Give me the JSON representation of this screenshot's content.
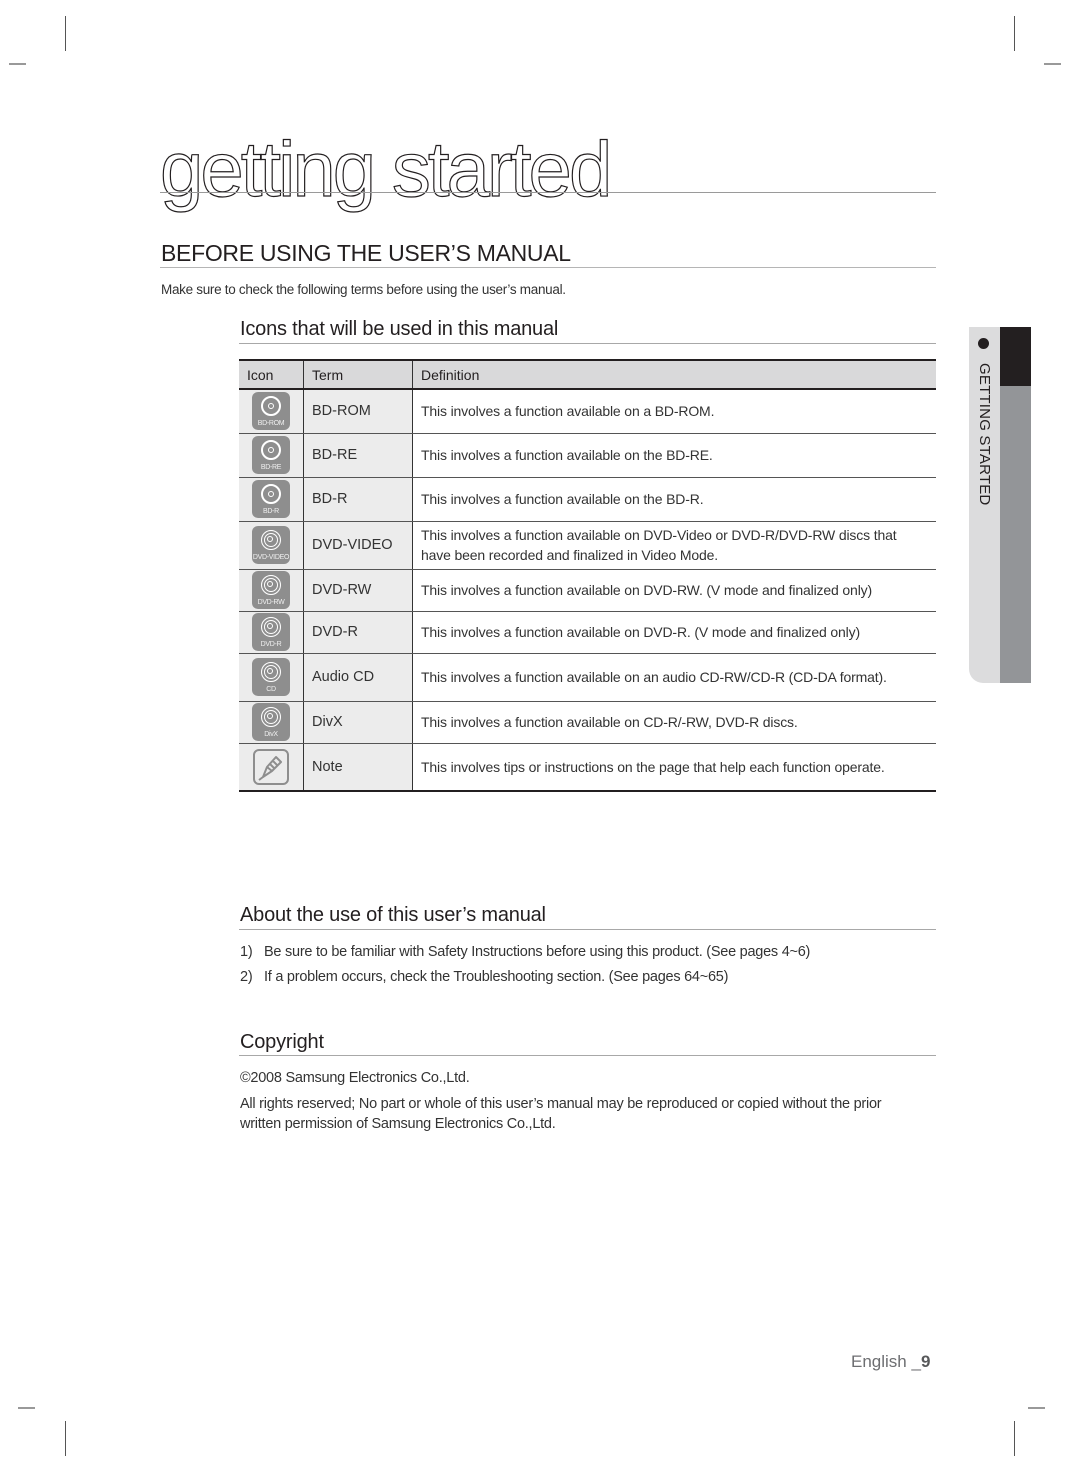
{
  "page": {
    "chapter_title": "getting started",
    "section_title": "BEFORE USING THE USER’S MANUAL",
    "intro": "Make sure to check the following terms before using the user’s manual.",
    "side_tab": {
      "label": "GETTING STARTED"
    },
    "footer": {
      "language": "English _",
      "page_number": "9"
    }
  },
  "icons_section": {
    "title": "Icons that will be used in this manual",
    "table": {
      "headers": [
        "Icon",
        "Term",
        "Definition"
      ],
      "rows": [
        {
          "icon": "bd-rom-disc-icon",
          "icon_label": "BD-ROM",
          "term": "BD-ROM",
          "definition": "This involves a function available on a BD-ROM."
        },
        {
          "icon": "bd-re-disc-icon",
          "icon_label": "BD-RE",
          "term": "BD-RE",
          "definition": "This involves a function available on the BD-RE."
        },
        {
          "icon": "bd-r-disc-icon",
          "icon_label": "BD-R",
          "term": "BD-R",
          "definition": "This involves a function available on the BD-R."
        },
        {
          "icon": "dvd-video-disc-icon",
          "icon_label": "DVD-VIDEO",
          "term": "DVD-VIDEO",
          "definition": "This involves a function available on DVD-Video or DVD-R/DVD-RW discs that have been recorded and finalized in Video Mode."
        },
        {
          "icon": "dvd-rw-disc-icon",
          "icon_label": "DVD-RW",
          "term": "DVD-RW",
          "definition": "This involves a function available on DVD-RW. (V mode and finalized only)"
        },
        {
          "icon": "dvd-r-disc-icon",
          "icon_label": "DVD-R",
          "term": "DVD-R",
          "definition": "This involves a function available on DVD-R. (V mode and finalized only)"
        },
        {
          "icon": "audio-cd-disc-icon",
          "icon_label": "CD",
          "term": "Audio CD",
          "definition": "This involves a function available on an audio CD-RW/CD-R (CD-DA format)."
        },
        {
          "icon": "divx-disc-icon",
          "icon_label": "DivX",
          "term": "DivX",
          "definition": "This involves a function available on CD-R/-RW, DVD-R discs."
        },
        {
          "icon": "note-pencil-icon",
          "icon_label": "",
          "term": "Note",
          "definition": "This involves tips or instructions on the page that help each function operate."
        }
      ]
    }
  },
  "about_section": {
    "title": "About the use of this user’s manual",
    "items": [
      {
        "num": "1)",
        "text": "Be sure to be familiar with Safety Instructions before using this product. (See pages 4~6)"
      },
      {
        "num": "2)",
        "text": "If a problem occurs, check the Troubleshooting section. (See pages 64~65)"
      }
    ]
  },
  "copyright_section": {
    "title": "Copyright",
    "line1": "©2008 Samsung Electronics Co.,Ltd.",
    "line2": "All rights reserved; No part or whole of this user’s manual may be reproduced or copied without the prior written permission of Samsung Electronics Co.,Ltd."
  }
}
